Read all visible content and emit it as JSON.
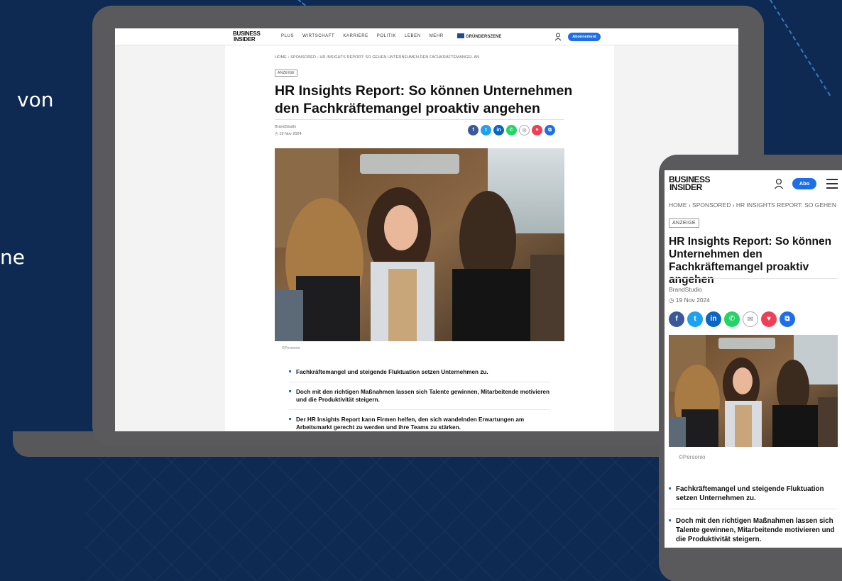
{
  "backdrop": {
    "left_text_lines": [
      "von",
      "ne"
    ]
  },
  "laptop": {
    "nav": {
      "logo_line1": "BUSINESS",
      "logo_line2": "INSIDER",
      "menu": [
        "PLUS",
        "WIRTSCHAFT",
        "KARRIERE",
        "POLITIK",
        "LEBEN",
        "MEHR"
      ],
      "partner": "GRÜNDERSZENE",
      "subscribe_label": "Abonnement"
    },
    "article": {
      "breadcrumb": "HOME  ›  SPONSORED  ›  HR INSIGHTS REPORT: SO GEHEN UNTERNEHMEN DEN FACHKRÄFTEMANGEL AN",
      "tag": "ANZEIGE",
      "title": "HR Insights Report: So können Unternehmen den Fachkräftemangel proaktiv angehen",
      "author": "BrandStudio",
      "date": "◷ 19 Nov 2024",
      "photo_credit": "©Personio",
      "bullets": [
        "Fachkräftemangel und steigende Fluktuation setzen Unternehmen zu.",
        "Doch mit den richtigen Maßnahmen lassen sich Talente gewinnen, Mitarbeitende motivieren und die Produktivität steigern.",
        "Der HR Insights Report kann Firmen helfen, den sich wandelnden Erwartungen am Arbeitsmarkt gerecht zu werden und ihre Teams zu stärken."
      ]
    }
  },
  "phone": {
    "nav": {
      "logo_line1": "BUSINESS",
      "logo_line2": "INSIDER",
      "subscribe_label": "Abo"
    },
    "article": {
      "breadcrumb": "HOME  ›  SPONSORED  ›  HR INSIGHTS REPORT: SO GEHEN",
      "tag": "ANZEIGE",
      "title": "HR Insights Report: So können Unternehmen den Fachkräftemangel proaktiv angehen",
      "author": "BrandStudio",
      "date": "◷ 19 Nov 2024",
      "photo_credit": "©Personio",
      "bullets": [
        "Fachkräftemangel und steigende Fluktuation setzen Unternehmen zu.",
        "Doch mit den richtigen Maßnahmen lassen sich Talente gewinnen, Mitarbeitende motivieren und die Produktivität steigern."
      ]
    }
  },
  "share_icons": [
    {
      "name": "facebook-share-icon",
      "glyph": "f",
      "cls": "c-fb"
    },
    {
      "name": "twitter-share-icon",
      "glyph": "t",
      "cls": "c-tw"
    },
    {
      "name": "linkedin-share-icon",
      "glyph": "in",
      "cls": "c-li"
    },
    {
      "name": "whatsapp-share-icon",
      "glyph": "✆",
      "cls": "c-wa"
    },
    {
      "name": "email-share-icon",
      "glyph": "✉",
      "cls": "c-ml"
    },
    {
      "name": "pocket-share-icon",
      "glyph": "♥",
      "cls": "c-pk"
    },
    {
      "name": "copy-link-icon",
      "glyph": "⧉",
      "cls": "c-cp"
    }
  ],
  "colors": {
    "background": "#0e2a52",
    "accent": "#1d6fe8",
    "device_frame": "#5a5a5d"
  }
}
